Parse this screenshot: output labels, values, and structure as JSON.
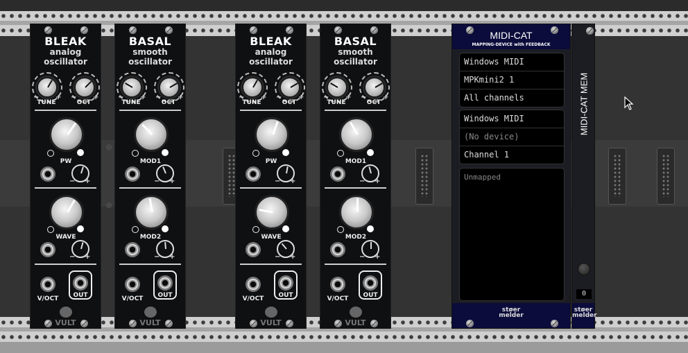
{
  "modules": [
    {
      "title": "BLEAK",
      "subtitle1": "analog",
      "subtitle2": "oscillator",
      "knob1_label": "TUNE",
      "knob2_label": "OCT",
      "mid_label": "PW",
      "lower_label": "WAVE",
      "jack1_label": "V/OCT",
      "jack2_label": "OUT",
      "brand": "VULT"
    },
    {
      "title": "BASAL",
      "subtitle1": "smooth",
      "subtitle2": "oscillator",
      "knob1_label": "TUNE",
      "knob2_label": "OCT",
      "mid_label": "MOD1",
      "lower_label": "MOD2",
      "jack1_label": "V/OCT",
      "jack2_label": "OUT",
      "brand": "VULT"
    },
    {
      "title": "BLEAK",
      "subtitle1": "analog",
      "subtitle2": "oscillator",
      "knob1_label": "TUNE",
      "knob2_label": "OCT",
      "mid_label": "PW",
      "lower_label": "WAVE",
      "jack1_label": "V/OCT",
      "jack2_label": "OUT",
      "brand": "VULT"
    },
    {
      "title": "BASAL",
      "subtitle1": "smooth",
      "subtitle2": "oscillator",
      "knob1_label": "TUNE",
      "knob2_label": "OCT",
      "mid_label": "MOD1",
      "lower_label": "MOD2",
      "jack1_label": "V/OCT",
      "jack2_label": "OUT",
      "brand": "VULT"
    }
  ],
  "midicat": {
    "title": "MIDI-CAT",
    "subtitle": "MAPPING-DEVICE with FEEDBACK",
    "input": [
      "Windows MIDI",
      "MPKmini2 1",
      "All channels"
    ],
    "output": [
      "Windows MIDI",
      "(No device)",
      "Channel 1"
    ],
    "mapping_placeholder": "Unmapped",
    "brand_line1": "støer",
    "brand_line2": "melder"
  },
  "mem": {
    "title": "MIDI-CAT MEM",
    "display_value": "0",
    "brand_line1": "støer",
    "brand_line2": "melder"
  },
  "colors": {
    "rack_rail": "#cfcfcf",
    "panel_black": "#0f1012",
    "stoermelder_header": "#0b0c3b"
  }
}
